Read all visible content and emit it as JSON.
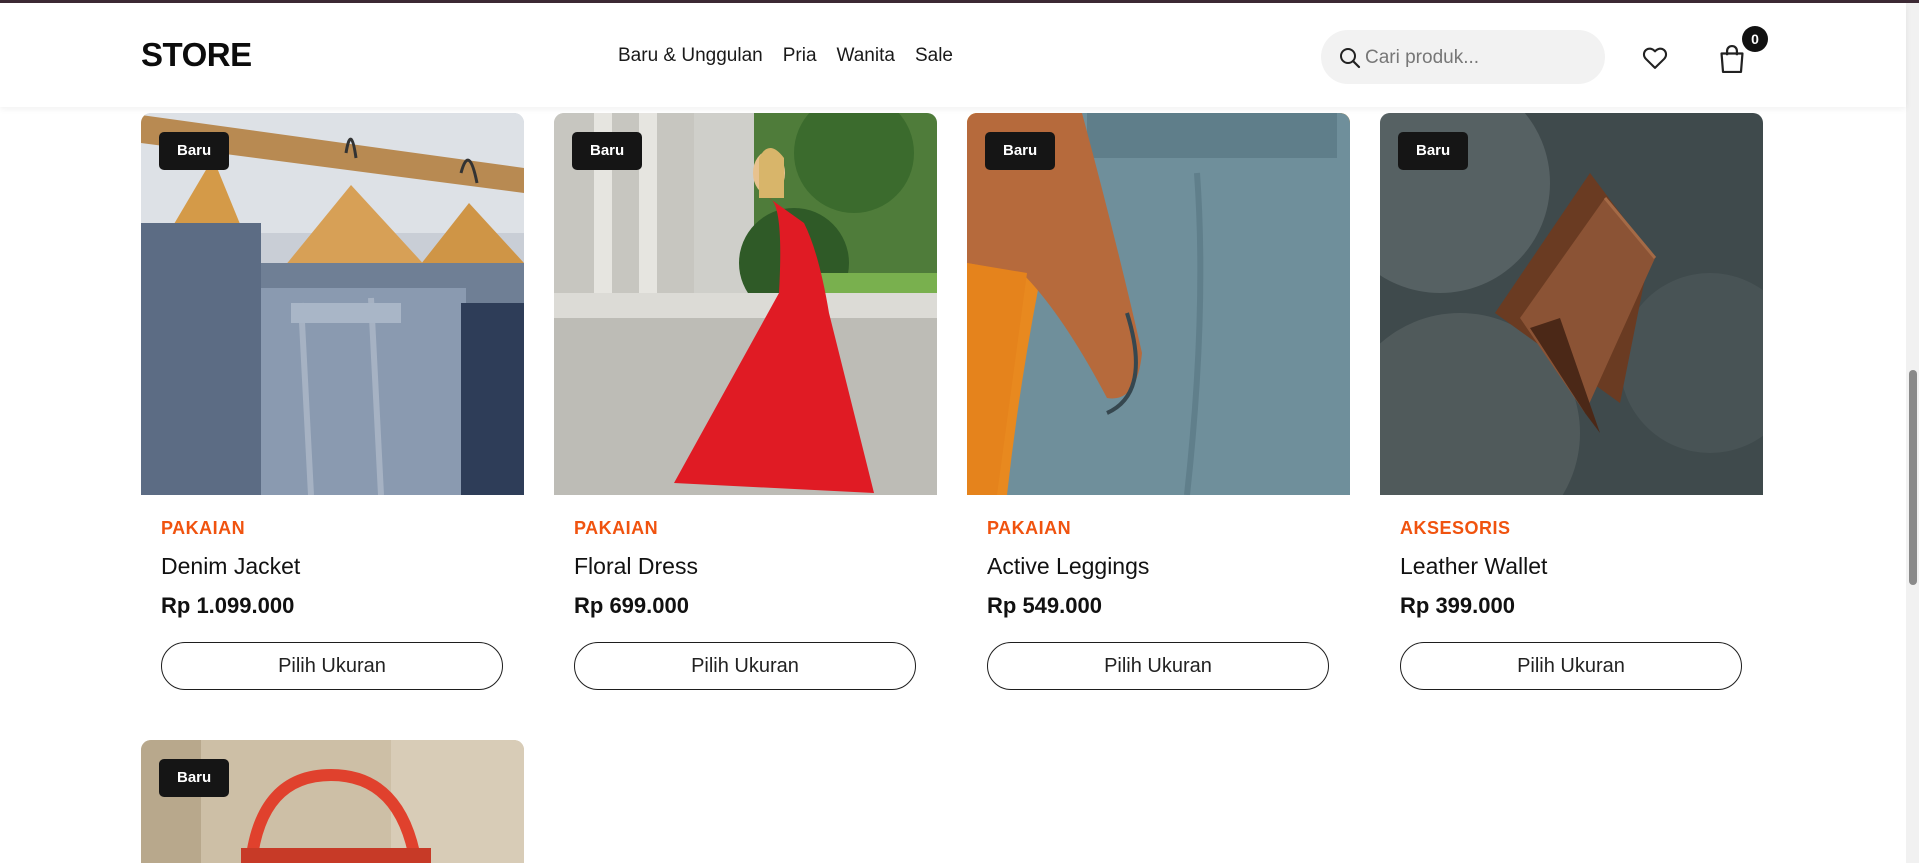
{
  "header": {
    "logo": "STORE",
    "nav": [
      "Baru & Unggulan",
      "Pria",
      "Wanita",
      "Sale"
    ],
    "search_placeholder": "Cari produk...",
    "cart_count": "0",
    "icons": {
      "search": "search-icon",
      "wishlist": "heart-icon",
      "cart": "shopping-bag-icon"
    }
  },
  "products": [
    {
      "badge": "Baru",
      "category": "PAKAIAN",
      "name": "Denim Jacket",
      "price": "Rp 1.099.000",
      "button": "Pilih Ukuran"
    },
    {
      "badge": "Baru",
      "category": "PAKAIAN",
      "name": "Floral Dress",
      "price": "Rp 699.000",
      "button": "Pilih Ukuran"
    },
    {
      "badge": "Baru",
      "category": "PAKAIAN",
      "name": "Active Leggings",
      "price": "Rp 549.000",
      "button": "Pilih Ukuran"
    },
    {
      "badge": "Baru",
      "category": "AKSESORIS",
      "name": "Leather Wallet",
      "price": "Rp 399.000",
      "button": "Pilih Ukuran"
    },
    {
      "badge": "Baru"
    }
  ],
  "colors": {
    "accent": "#f0530f",
    "badge_bg": "#151515",
    "text": "#111111"
  }
}
